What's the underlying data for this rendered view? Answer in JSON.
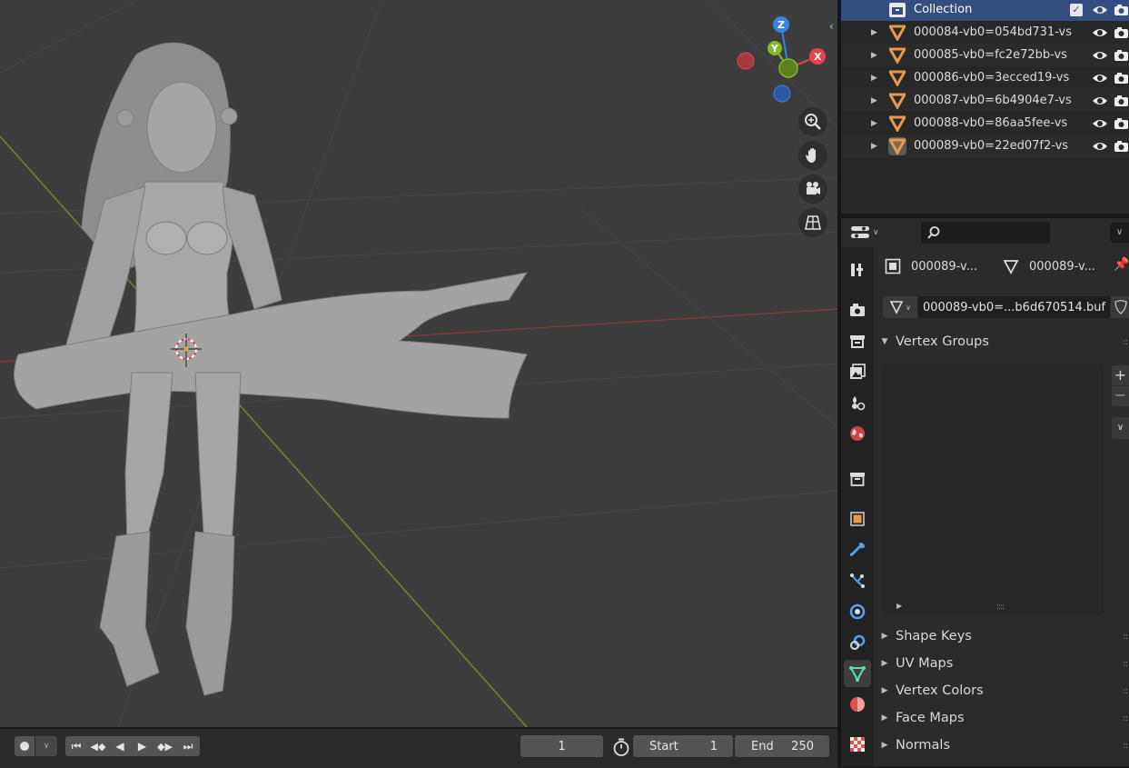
{
  "outliner": {
    "collection_label": "Collection",
    "objects": [
      {
        "label": "000084-vb0=054bd731-vs",
        "active": false
      },
      {
        "label": "000085-vb0=fc2e72bb-vs",
        "active": false
      },
      {
        "label": "000086-vb0=3ecced19-vs",
        "active": false
      },
      {
        "label": "000087-vb0=6b4904e7-vs",
        "active": false
      },
      {
        "label": "000088-vb0=86aa5fee-vs",
        "active": false
      },
      {
        "label": "000089-vb0=22ed07f2-vs",
        "active": true
      }
    ]
  },
  "properties": {
    "search_placeholder": "",
    "breadcrumb_object": "000089-v...",
    "breadcrumb_mesh": "000089-v...",
    "mesh_datablock_name": "000089-vb0=...b6d670514.buf",
    "panels": {
      "vertex_groups": "Vertex Groups",
      "shape_keys": "Shape Keys",
      "uv_maps": "UV Maps",
      "vertex_colors": "Vertex Colors",
      "face_maps": "Face Maps",
      "normals": "Normals"
    }
  },
  "viewport": {
    "gizmo": {
      "x_label": "X",
      "y_label": "Y",
      "z_label": "Z"
    }
  },
  "timeline": {
    "current_frame": "1",
    "start_label": "Start",
    "start_value": "1",
    "end_label": "End",
    "end_value": "250"
  },
  "colors": {
    "viewport_bg": "#3d3d3d",
    "x_axis": "#e8414f",
    "y_axis": "#84b929",
    "z_axis": "#3b82e0",
    "selection": "#334d80",
    "mesh_orange": "#e79a4b",
    "active_tab_green": "#5fe0a0"
  }
}
